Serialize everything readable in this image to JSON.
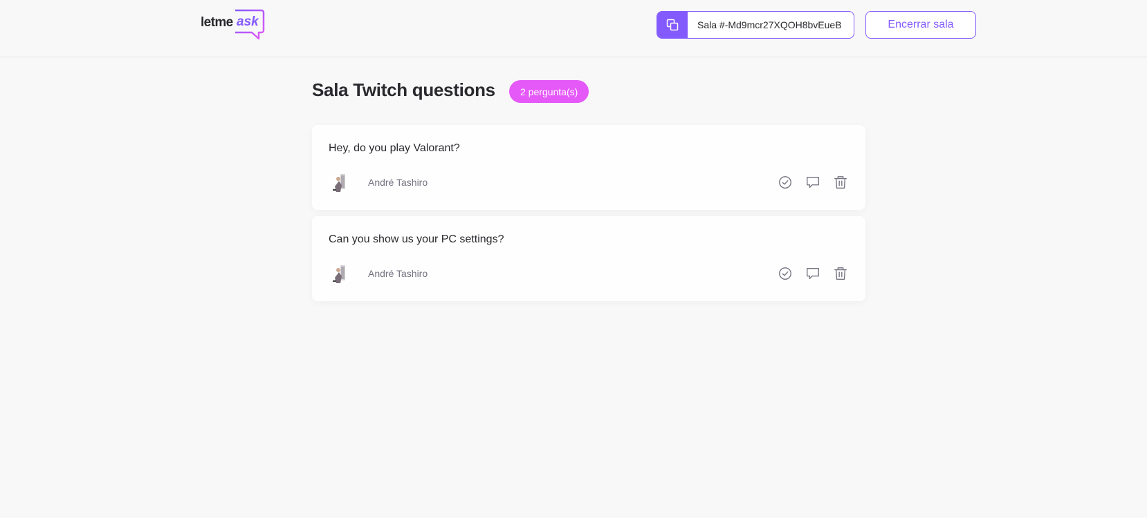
{
  "header": {
    "logo": {
      "part1": "letme",
      "part2": "ask"
    },
    "room_code": "Sala #-Md9mcr27XQOH8bvEueB",
    "close_room_label": "Encerrar sala",
    "icons": {
      "copy": "copy-icon"
    }
  },
  "room": {
    "title": "Sala Twitch questions",
    "question_count": "2 pergunta(s)"
  },
  "questions": [
    {
      "content": "Hey, do you play Valorant?",
      "author": "André Tashiro",
      "icons": [
        "check-icon",
        "answer-icon",
        "delete-icon"
      ]
    },
    {
      "content": "Can you show us your PC settings?",
      "author": "André Tashiro",
      "icons": [
        "check-icon",
        "answer-icon",
        "delete-icon"
      ]
    }
  ],
  "colors": {
    "primary": "#835afd",
    "badge": "#e559f9",
    "text": "#29292e",
    "muted": "#737380",
    "background": "#f8f8f8"
  }
}
